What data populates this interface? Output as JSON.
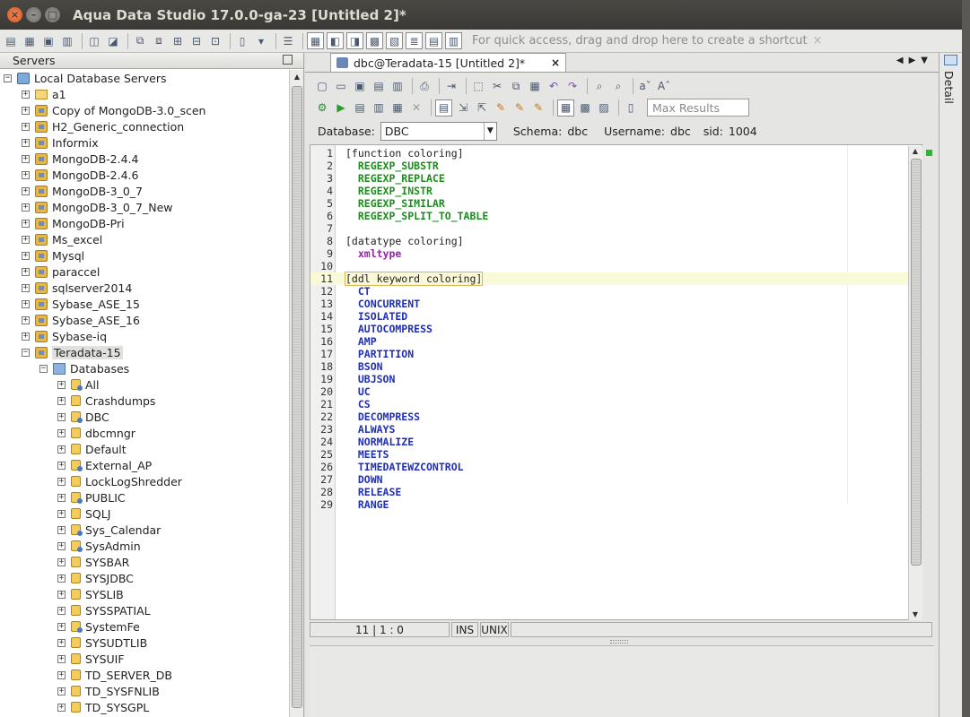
{
  "window": {
    "title": "Aqua Data Studio 17.0.0-ga-23 [Untitled 2]*",
    "close_glyph": "×",
    "min_glyph": "–",
    "max_glyph": "□"
  },
  "toolbar": {
    "quick_access": "For quick access, drag and drop here to create a shortcut",
    "quick_close": "×"
  },
  "servers_panel": {
    "title": "Servers",
    "root": "Local Database Servers",
    "servers": [
      "a1",
      "Copy of MongoDB-3.0_scen",
      "H2_Generic_connection",
      "Informix",
      "MongoDB-2.4.4",
      "MongoDB-2.4.6",
      "MongoDB-3_0_7",
      "MongoDB-3_0_7_New",
      "MongoDB-Pri",
      "Ms_excel",
      "Mysql",
      "paraccel",
      "sqlserver2014",
      "Sybase_ASE_15",
      "Sybase_ASE_16",
      "Sybase-iq",
      "Teradata-15"
    ],
    "databases_label": "Databases",
    "databases": [
      "All",
      "Crashdumps",
      "DBC",
      "dbcmngr",
      "Default",
      "External_AP",
      "LockLogShredder",
      "PUBLIC",
      "SQLJ",
      "Sys_Calendar",
      "SysAdmin",
      "SYSBAR",
      "SYSJDBC",
      "SYSLIB",
      "SYSSPATIAL",
      "SystemFe",
      "SYSUDTLIB",
      "SYSUIF",
      "TD_SERVER_DB",
      "TD_SYSFNLIB",
      "TD_SYSGPL"
    ]
  },
  "editor_tab": {
    "label": "dbc@Teradata-15 [Untitled 2]*",
    "close": "×"
  },
  "query_toolbar": {
    "max_results_placeholder": "Max Results"
  },
  "connection": {
    "database_label": "Database:",
    "database_value": "DBC",
    "schema_label": "Schema:",
    "schema_value": "dbc",
    "username_label": "Username:",
    "username_value": "dbc",
    "sid_label": "sid:",
    "sid_value": "1004"
  },
  "code_lines": [
    "[function coloring]",
    "  REGEXP_SUBSTR",
    "  REGEXP_REPLACE",
    "  REGEXP_INSTR",
    "  REGEXP_SIMILAR",
    "  REGEXP_SPLIT_TO_TABLE",
    "",
    "[datatype coloring]",
    "  xmltype",
    "",
    "[ddl keyword coloring]",
    "  CT",
    "  CONCURRENT",
    "  ISOLATED",
    "  AUTOCOMPRESS",
    "  AMP",
    "  PARTITION",
    "  BSON",
    "  UBJSON",
    "  UC",
    "  CS",
    "  DECOMPRESS",
    "  ALWAYS",
    "  NORMALIZE",
    "  MEETS",
    "  TIMEDATEWZCONTROL",
    "  DOWN",
    "  RELEASE",
    "  RANGE"
  ],
  "status": {
    "position": "11 | 1 : 0",
    "mode": "INS",
    "line_ending": "UNIX"
  },
  "right_panel": {
    "label": "Detail"
  },
  "colors": {
    "function": "#1c8c1c",
    "datatype": "#9a1fb0",
    "keyword": "#1f2fb8"
  }
}
